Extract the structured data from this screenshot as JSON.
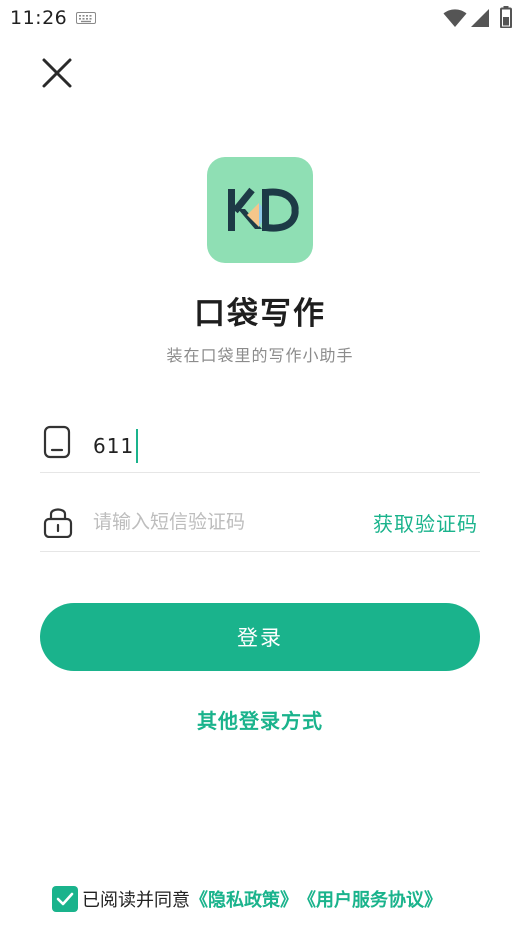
{
  "status_bar": {
    "time": "11:26",
    "icons": [
      "keyboard-icon",
      "wifi-icon",
      "signal-icon",
      "battery-icon"
    ]
  },
  "header": {
    "close_icon": "close-icon"
  },
  "app": {
    "name": "口袋写作",
    "slogan": "装在口袋里的写作小助手",
    "logo_color": "#8fdfb4"
  },
  "form": {
    "phone_value": "611",
    "phone_icon": "phone-icon",
    "code_placeholder": "请输入短信验证码",
    "code_icon": "lock-icon",
    "get_code_label": "获取验证码"
  },
  "actions": {
    "login_label": "登录",
    "other_login_label": "其他登录方式"
  },
  "agreement": {
    "checked": true,
    "text": "已阅读并同意",
    "privacy_label": "《隐私政策》",
    "terms_label": "《用户服务协议》"
  },
  "colors": {
    "accent": "#1ab38c",
    "text": "#222222",
    "muted": "#8c8c8c"
  }
}
